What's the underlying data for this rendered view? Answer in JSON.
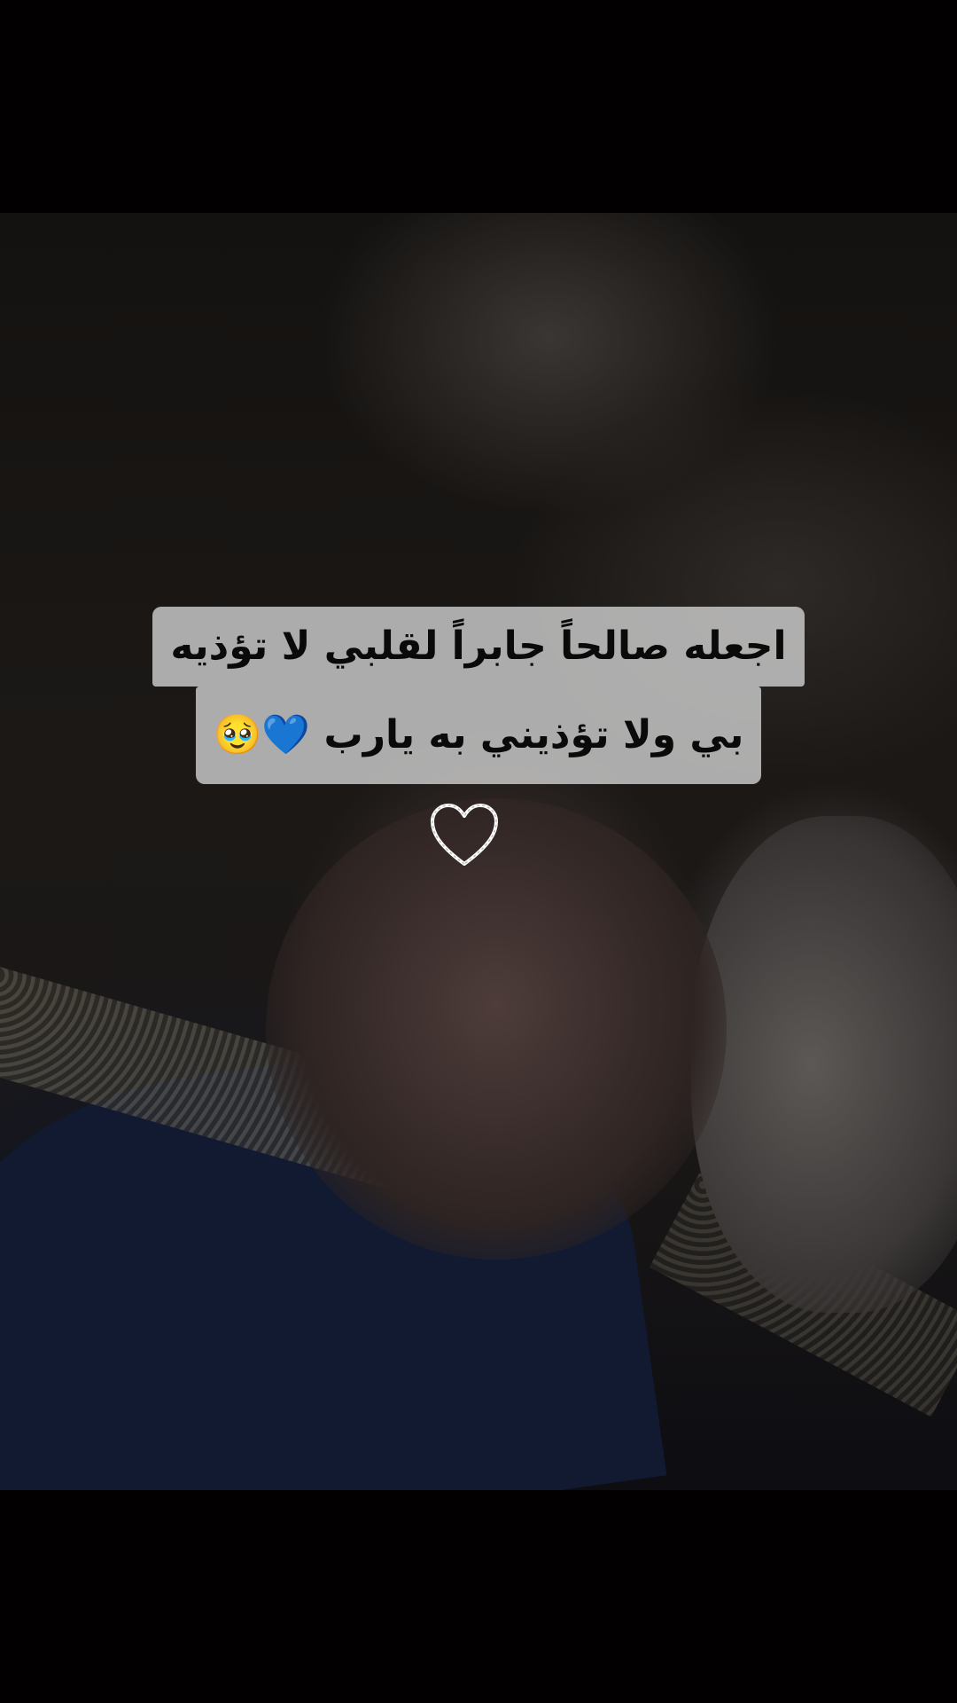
{
  "caption": {
    "line1": "اجعله صالحاً جابراً لقلبي لا تؤذيه",
    "line2": "بي ولا تؤذيني به يارب 💙🥹"
  },
  "sticker": {
    "icon": "heart-outline-icon",
    "color": "#ffffff"
  },
  "colors": {
    "caption_bg": "#d2d2d2",
    "caption_text": "#0a0a0a",
    "letterbox": "#020001"
  }
}
